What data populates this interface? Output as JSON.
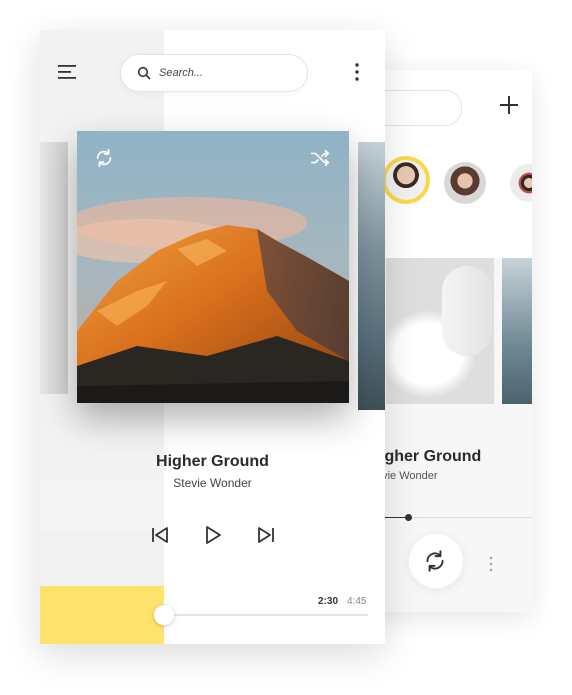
{
  "search": {
    "placeholder": "Search..."
  },
  "now_playing": {
    "title": "Higher Ground",
    "artist": "Stevie Wonder"
  },
  "progress": {
    "current": "2:30",
    "total": "4:45",
    "fraction": 0.0
  },
  "back_screen": {
    "title": "igher Ground",
    "artist": "evie Wonder"
  },
  "icons": {
    "menu": "menu-icon",
    "search": "search-icon",
    "more": "more-vertical-icon",
    "repeat": "repeat-icon",
    "shuffle": "shuffle-icon",
    "previous": "skip-previous-icon",
    "play": "play-icon",
    "next": "skip-next-icon",
    "add": "plus-icon"
  },
  "colors": {
    "accent": "#fde36c",
    "avatar_ring": "#f9d94a",
    "text": "#2b2b2b"
  }
}
